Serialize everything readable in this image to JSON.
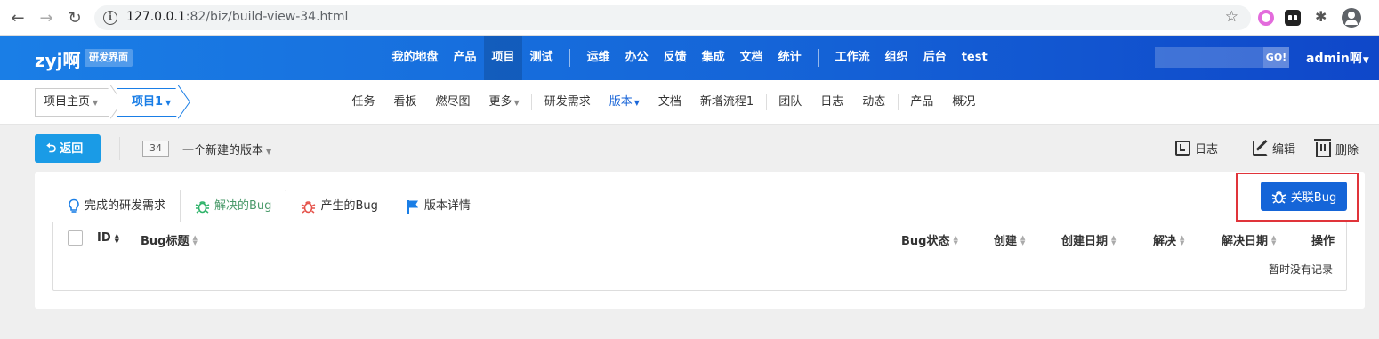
{
  "browser": {
    "url_host": "127.0.0.1",
    "url_path": ":82/biz/build-view-34.html"
  },
  "header": {
    "brand": "zyj啊",
    "badge": "研发界面",
    "nav": [
      {
        "label": "我的地盘"
      },
      {
        "label": "产品"
      },
      {
        "label": "项目",
        "active": true
      },
      {
        "label": "测试"
      },
      {
        "sep": true
      },
      {
        "label": "运维"
      },
      {
        "label": "办公"
      },
      {
        "label": "反馈"
      },
      {
        "label": "集成"
      },
      {
        "label": "文档"
      },
      {
        "label": "统计"
      },
      {
        "sep": true
      },
      {
        "label": "工作流"
      },
      {
        "label": "组织"
      },
      {
        "label": "后台"
      },
      {
        "label": "test"
      }
    ],
    "search_go": "GO!",
    "user": "admin啊"
  },
  "subbar": {
    "crumb_home": "项目主页",
    "crumb_project": "项目1",
    "nav": [
      {
        "label": "任务"
      },
      {
        "label": "看板"
      },
      {
        "label": "燃尽图"
      },
      {
        "label": "更多",
        "dropdown": true
      },
      {
        "sep": true
      },
      {
        "label": "研发需求"
      },
      {
        "label": "版本",
        "dropdown": true,
        "active": true
      },
      {
        "label": "文档"
      },
      {
        "label": "新增流程1"
      },
      {
        "sep": true
      },
      {
        "label": "团队"
      },
      {
        "label": "日志"
      },
      {
        "label": "动态"
      },
      {
        "sep": true
      },
      {
        "label": "产品"
      },
      {
        "label": "概况"
      }
    ]
  },
  "toolbar": {
    "back": "返回",
    "version_id": "34",
    "version_name": "一个新建的版本",
    "log": "日志",
    "edit": "编辑",
    "delete": "删除"
  },
  "tabs": {
    "stories": "完成的研发需求",
    "resolved_bugs": "解决的Bug",
    "created_bugs": "产生的Bug",
    "details": "版本详情"
  },
  "link_bug": "关联Bug",
  "table": {
    "col_id": "ID",
    "col_title": "Bug标题",
    "col_status": "Bug状态",
    "col_created": "创建",
    "col_created_date": "创建日期",
    "col_resolved": "解决",
    "col_resolved_date": "解决日期",
    "col_actions": "操作",
    "empty": "暂时没有记录"
  },
  "colors": {
    "header_start": "#1a7ee6",
    "header_end": "#0f47c9",
    "primary": "#1565d8",
    "back_button": "#1a9be6",
    "highlight": "#e0343a",
    "bug_resolved_icon": "#2fb36a",
    "bug_created_icon": "#e5534b",
    "flag_icon": "#1a7ee6",
    "lightbulb_icon": "#1a7ee6"
  }
}
